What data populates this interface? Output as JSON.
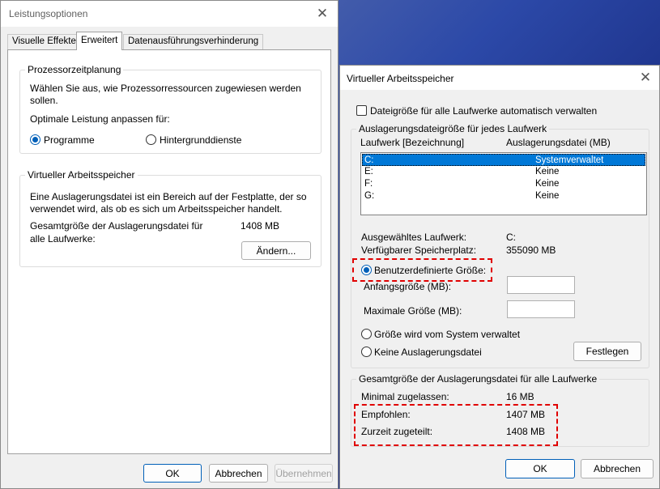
{
  "left_window": {
    "title": "Leistungsoptionen",
    "tabs": [
      "Visuelle Effekte",
      "Erweitert",
      "Datenausführungsverhinderung"
    ],
    "active_tab": "Erweitert",
    "proc_group": {
      "label": "Prozessorzeitplanung",
      "desc_line1": "Wählen Sie aus, wie Prozessorressourcen zugewiesen werden",
      "desc_line2": "sollen.",
      "optimize_label": "Optimale Leistung anpassen für:",
      "radio_programs": "Programme",
      "radio_background": "Hintergrunddienste",
      "selected": "Programme"
    },
    "vm_group": {
      "label": "Virtueller Arbeitsspeicher",
      "desc_line1": "Eine Auslagerungsdatei ist ein Bereich auf der Festplatte, der so",
      "desc_line2": "verwendet wird, als ob es sich um Arbeitsspeicher handelt.",
      "total_label_line1": "Gesamtgröße der Auslagerungsdatei für",
      "total_label_line2": "alle Laufwerke:",
      "total_value": "1408 MB",
      "change_button": "Ändern..."
    },
    "buttons": {
      "ok": "OK",
      "cancel": "Abbrechen",
      "apply": "Übernehmen"
    }
  },
  "right_window": {
    "title": "Virtueller Arbeitsspeicher",
    "auto_manage_label": "Dateigröße für alle Laufwerke automatisch verwalten",
    "auto_manage_checked": false,
    "drives_group": {
      "label": "Auslagerungsdateigröße für jedes Laufwerk",
      "col_drive": "Laufwerk [Bezeichnung]",
      "col_file": "Auslagerungsdatei (MB)",
      "rows": [
        {
          "drive": "C:",
          "value": "Systemverwaltet",
          "selected": true
        },
        {
          "drive": "E:",
          "value": "Keine",
          "selected": false
        },
        {
          "drive": "F:",
          "value": "Keine",
          "selected": false
        },
        {
          "drive": "G:",
          "value": "Keine",
          "selected": false
        }
      ],
      "selected_drive_label": "Ausgewähltes Laufwerk:",
      "selected_drive_value": "C:",
      "free_space_label": "Verfügbarer Speicherplatz:",
      "free_space_value": "355090 MB",
      "radio_custom": "Benutzerdefinierte Größe:",
      "initial_size_label": "Anfangsgröße (MB):",
      "initial_size_value": "",
      "max_size_label": "Maximale Größe (MB):",
      "max_size_value": "",
      "radio_system": "Größe wird vom System verwaltet",
      "radio_none": "Keine Auslagerungsdatei",
      "selected_option": "Benutzerdefinierte Größe:",
      "set_button": "Festlegen"
    },
    "total_group": {
      "label": "Gesamtgröße der Auslagerungsdatei für alle Laufwerke",
      "min_label": "Minimal zugelassen:",
      "min_value": "16 MB",
      "recommended_label": "Empfohlen:",
      "recommended_value": "1407 MB",
      "current_label": "Zurzeit zugeteilt:",
      "current_value": "1408 MB"
    },
    "buttons": {
      "ok": "OK",
      "cancel": "Abbrechen"
    }
  },
  "colors": {
    "accent": "#005fb8",
    "selection": "#0078d7",
    "highlight_dash": "#e00000"
  },
  "icons": {
    "close": "close-icon"
  }
}
